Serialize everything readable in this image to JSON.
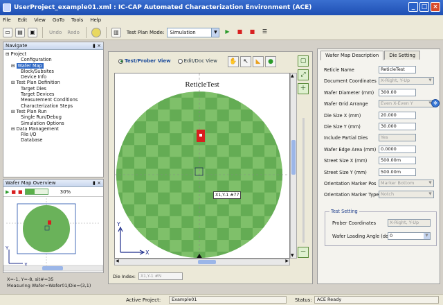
{
  "window": {
    "title": "UserProject_example01.xml : IC-CAP Automated Characterization Environment (ACE)"
  },
  "menu": [
    "File",
    "Edit",
    "View",
    "GoTo",
    "Tools",
    "Help"
  ],
  "toolbar": {
    "undo": "Undo",
    "redo": "Redo",
    "mode_label": "Test Plan Mode:",
    "mode_value": "Simulation"
  },
  "navigate": {
    "title": "Navigate",
    "tree": [
      {
        "label": "Project",
        "level": 0
      },
      {
        "label": "Configuration",
        "level": 1
      },
      {
        "label": "Wafer Map",
        "level": 1,
        "selected": true
      },
      {
        "label": "Block/Subsites",
        "level": 2
      },
      {
        "label": "Device Info",
        "level": 2
      },
      {
        "label": "Test Plan Definition",
        "level": 1
      },
      {
        "label": "Target Dies",
        "level": 2
      },
      {
        "label": "Target Devices",
        "level": 2
      },
      {
        "label": "Measurement Conditions",
        "level": 2
      },
      {
        "label": "Characterization Steps",
        "level": 2
      },
      {
        "label": "Test Plan Run",
        "level": 1
      },
      {
        "label": "Single Run/Debug",
        "level": 2
      },
      {
        "label": "Simulation Options",
        "level": 2
      },
      {
        "label": "Data Management",
        "level": 1
      },
      {
        "label": "File I/O",
        "level": 2
      },
      {
        "label": "Database",
        "level": 2
      }
    ]
  },
  "overview": {
    "title": "Wafer Map Overview",
    "zoom": "30%",
    "x_label": "X",
    "y_label": "Y"
  },
  "status_left": {
    "coords": "X=-1, Y=-8, sit#=35",
    "measuring": "Measuring Wafer=Wafer01/Die=(3,1)"
  },
  "view": {
    "test_prober": "Test/Prober View",
    "edit_doc": "Edit/Doc View",
    "reticle_title": "ReticleTest",
    "tooltip": "X1,Y-1 #77",
    "x_label": "X",
    "y_label": "Y",
    "die_index_label": "Die Index:",
    "die_index_value": "X1,Y-1 #N"
  },
  "right_panel": {
    "tab_description": "Wafer Map Description",
    "tab_die": "Die Setting",
    "fields": [
      {
        "label": "Reticle Name",
        "value": "ReticleTest"
      },
      {
        "label": "Document Coordinates",
        "value": "X-Right, Y-Up",
        "disabled": true,
        "combo": true
      },
      {
        "label": "Wafer Diameter (mm)",
        "value": "300.00"
      },
      {
        "label": "Wafer Grid Arrange",
        "value": "Even X-Even Y",
        "disabled": true,
        "combo": true
      },
      {
        "label": "Die Size X (mm)",
        "value": "20.000"
      },
      {
        "label": "Die Size Y (mm)",
        "value": "30.000"
      },
      {
        "label": "Include Partial Dies",
        "value": "Yes",
        "disabled": true
      },
      {
        "label": "Wafer Edge Area (mm)",
        "value": "0.0000"
      },
      {
        "label": "Street Size X (mm)",
        "value": "500.00m"
      },
      {
        "label": "Street Size Y (mm)",
        "value": "500.00m"
      },
      {
        "label": "Orientation Marker Pos",
        "value": "Marker Bottom",
        "disabled": true,
        "combo": true
      },
      {
        "label": "Orientation Marker Type",
        "value": "Notch",
        "disabled": true,
        "combo": true
      }
    ],
    "test_setting": {
      "title": "Test Setting",
      "prober_label": "Prober Coordinates",
      "prober_value": "X-Right, Y-Up",
      "loading_label": "Wafer Loading Angle (deg)",
      "loading_value": "0"
    }
  },
  "status_bar": {
    "active_project_label": "Active Project:",
    "active_project": "Example01",
    "status_label": "Status:",
    "status": "ACE Ready"
  },
  "colors": {
    "die_light": "#7fc06a",
    "die_dark": "#4f9a42",
    "selected_die": "#d81e1e",
    "accent": "#316ac5"
  }
}
